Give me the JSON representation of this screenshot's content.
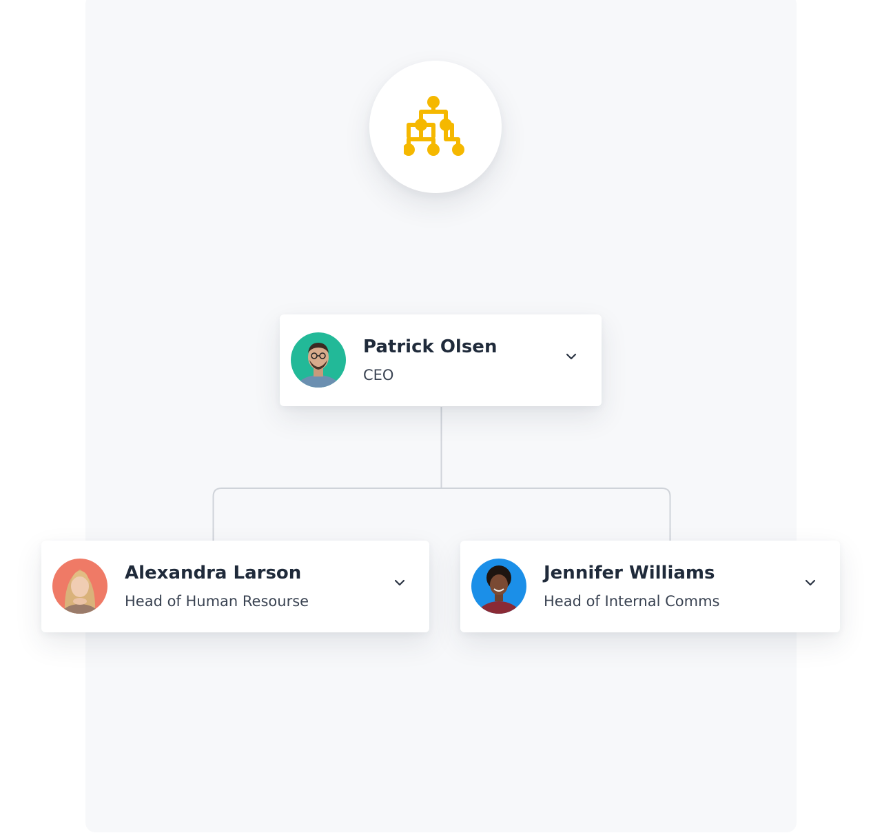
{
  "org_icon": {
    "icon": "org-chart-icon",
    "color": "#f5b800"
  },
  "employees": [
    {
      "id": "ceo",
      "name": "Patrick Olsen",
      "role": "CEO",
      "avatar_bg": "#22b998",
      "expand_icon": "chevron-down-icon"
    },
    {
      "id": "hr",
      "name": "Alexandra Larson",
      "role": "Head of Human Resourse",
      "avatar_bg": "#ef7a66",
      "expand_icon": "chevron-down-icon"
    },
    {
      "id": "comms",
      "name": "Jennifer Williams",
      "role": "Head of Internal Comms",
      "avatar_bg": "#1b8fe8",
      "expand_icon": "chevron-down-icon"
    }
  ],
  "colors": {
    "panel_bg": "#f7f8fa",
    "connector": "#cfd3d9",
    "name_text": "#1f2a3a",
    "role_text": "#3a4352"
  }
}
